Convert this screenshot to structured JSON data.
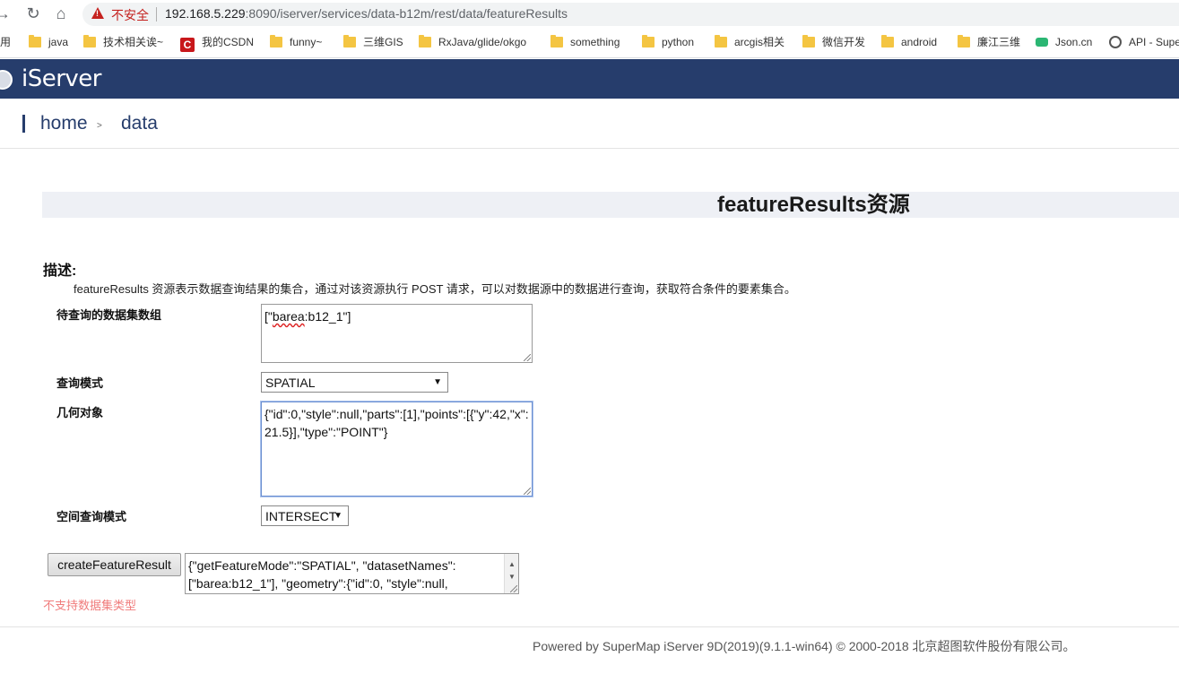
{
  "browser": {
    "insecure_label": "不安全",
    "url_host": "192.168.5.229",
    "url_rest": ":8090/iserver/services/data-b12m/rest/data/featureResults"
  },
  "bookmarks": {
    "items": [
      {
        "label": "用",
        "icon": "none"
      },
      {
        "label": "java",
        "icon": "folder-icon"
      },
      {
        "label": "技术相关诶~",
        "icon": "folder-icon"
      },
      {
        "label": "我的CSDN",
        "icon": "csdn-icon"
      },
      {
        "label": "funny~",
        "icon": "folder-icon"
      },
      {
        "label": "三维GIS",
        "icon": "folder-icon"
      },
      {
        "label": "RxJava/glide/okgo",
        "icon": "folder-icon"
      },
      {
        "label": "something",
        "icon": "folder-icon"
      },
      {
        "label": "python",
        "icon": "folder-icon"
      },
      {
        "label": "arcgis相关",
        "icon": "folder-icon"
      },
      {
        "label": "微信开发",
        "icon": "folder-icon"
      },
      {
        "label": "android",
        "icon": "folder-icon"
      },
      {
        "label": "廉江三维",
        "icon": "folder-icon"
      },
      {
        "label": "Json.cn",
        "icon": "json-icon"
      },
      {
        "label": "API - Supe",
        "icon": "globe-icon"
      }
    ]
  },
  "header": {
    "logo_text": "iServer"
  },
  "breadcrumb": {
    "home": "home",
    "separator": ">",
    "current": "data"
  },
  "page": {
    "title": "featureResults资源",
    "desc_heading": "描述:",
    "desc_text": "featureResults 资源表示数据查询结果的集合，通过对该资源执行 POST 请求，可以对数据源中的数据进行查询，获取符合条件的要素集合。"
  },
  "form": {
    "datasets_label": "待查询的数据集数组",
    "datasets_value_prefix": "[\"",
    "datasets_value_word": "barea",
    "datasets_value_suffix": ":b12_1\"]",
    "mode_label": "查询模式",
    "mode_value": "SPATIAL",
    "geometry_label": "几何对象",
    "geometry_value": "{\"id\":0,\"style\":null,\"parts\":[1],\"points\":[{\"y\":42,\"x\":21.5}],\"type\":\"POINT\"}",
    "spatial_mode_label": "空间查询模式",
    "spatial_mode_value": "INTERSECT",
    "submit_label": "createFeatureResult",
    "request_body": "{\"getFeatureMode\":\"SPATIAL\", \"datasetNames\":[\"barea:b12_1\"], \"geometry\":{\"id\":0, \"style\":null,",
    "error_text": "不支持数据集类型"
  },
  "footer": {
    "text": "Powered by SuperMap iServer 9D(2019)(9.1.1-win64) © 2000-2018 北京超图软件股份有限公司。"
  },
  "colors": {
    "brand": "#263d6c",
    "error": "#f07c7c",
    "insecure": "#c5221f"
  }
}
